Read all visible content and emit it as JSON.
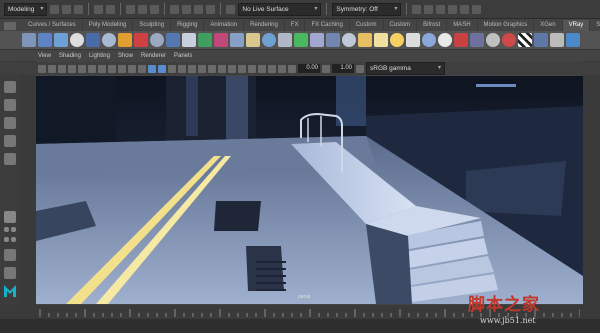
{
  "statusline": {
    "mode": "Modeling",
    "live_surface": "No Live Surface",
    "symmetry": "Symmetry: Off"
  },
  "shelf_tabs": [
    "Curves / Surfaces",
    "Poly Modeling",
    "Sculpting",
    "Rigging",
    "Animation",
    "Rendering",
    "FX",
    "FX Caching",
    "Custom",
    "Custom",
    "Bifrost",
    "MASH",
    "Motion Graphics",
    "XGen",
    "VRay",
    "Scripts"
  ],
  "active_shelf_tab": "VRay",
  "panel_menu": [
    "View",
    "Shading",
    "Lighting",
    "Show",
    "Renderer",
    "Panels"
  ],
  "viewport_toolbar": {
    "exposure": "0.00",
    "gamma": "1.00",
    "color_space": "sRGB gamma"
  },
  "viewport": {
    "camera": "persp"
  },
  "watermark": {
    "site_name": "脚本之家",
    "url": "www.jb51.net"
  },
  "colors": {
    "ui_dark": "#444444",
    "shelf_bg": "#535353",
    "scene_floor": "#8ea1c3",
    "scene_stripe": "#f3e08a",
    "watermark_red": "#c0392b",
    "maya_logo": "#19b1c8"
  }
}
